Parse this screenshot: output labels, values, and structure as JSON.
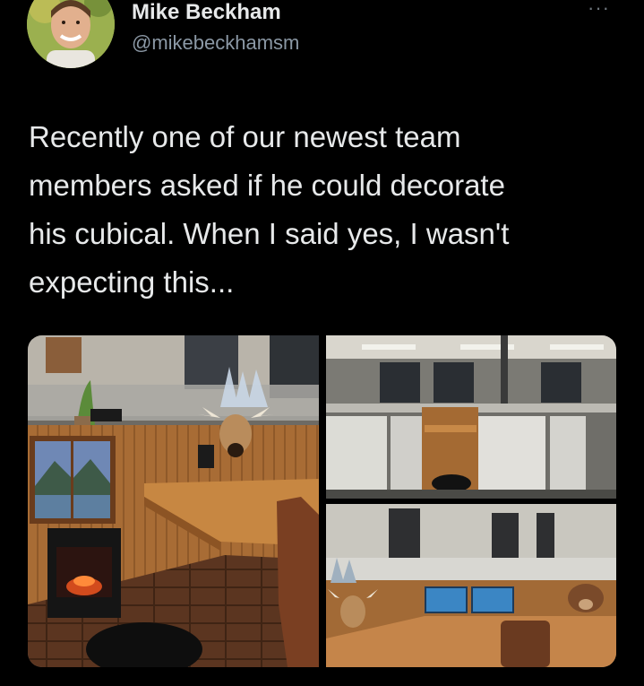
{
  "author": {
    "name": "Mike Beckham",
    "handle": "@mikebeckhamsm"
  },
  "tweet": {
    "text": "Recently one of our newest team\nmembers asked if he could decorate\nhis cubical. When I said yes, I wasn't\nexpecting this..."
  },
  "icons": {
    "more": "more-options-icon"
  },
  "colors": {
    "background": "#000000",
    "text": "#e7e9ea",
    "secondary_text": "#8b98a5"
  }
}
